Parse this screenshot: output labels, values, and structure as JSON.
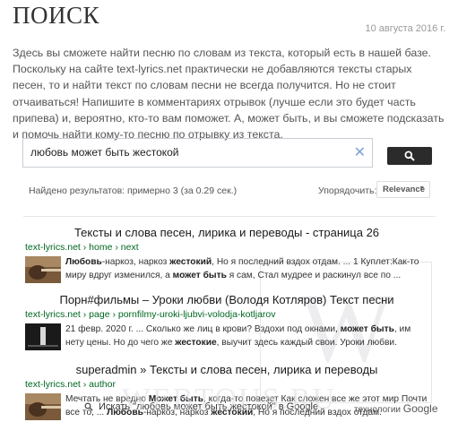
{
  "page": {
    "title": "ПОИСК",
    "date": "10 августа 2016 г.",
    "intro": "Здесь вы сможете найти песню по словам из текста, который есть в нашей базе. Поскольку на сайте text-lyrics.net практически не добавляются тексты старых песен, то и найти текст по словам песни не всегда получится. Но не стоит отчаиваться! Напишите в комментариях отрывок (лучше если это будет часть припева) и, вероятно, кто-то вам поможет. А, может быть, и вы сможете подсказать и помочь найти кому-то песню по отрывку из текста."
  },
  "search": {
    "query": "любовь может быть жестокой",
    "clear_glyph": "✕"
  },
  "stats": {
    "count": "Найдено результатов: примерно 3 (за 0.29 сек.)",
    "order_label": "Упорядочить:",
    "order_value": "Relevance"
  },
  "results": [
    {
      "title": "Тексты и слова песен, лирика и переводы - страница 26",
      "url": "text-lyrics.net › home › next",
      "snippet_html": "<b>Любовь</b>-наркоз, наркоз <b>жестокий</b>, Но я последний вздох отдам. ... 1 Куплет:Как-то миру вдруг изменился, а <b>может быть</b> я сам, Стал мудрее и раскинул все по ..."
    },
    {
      "title": "Порн#фильмы – Уроки любви (Володя Котляров) Текст песни",
      "url": "text-lyrics.net › page › pornfilmy-uroki-ljubvi-volodja-kotljarov",
      "snippet_html": "21 февр. 2020 г. ... Сколько же лиц в крови? Вздохи под окнами, <b>может быть</b>, им нету цены. Но до чего же <b>жестокие</b>, выучит здесь каждый свои. Уроки любви. Выверни, ..."
    },
    {
      "title": "superadmin » Тексты и слова песен, лирика и переводы",
      "url": "text-lyrics.net › author",
      "snippet_html": "Мечтать не вредно <b>Может быть</b>, когда-то повезет Как сложен все же этот мир Почти все то, ... <b>Любовь</b>-наркоз, наркоз <b>жестокий</b>, Но я последний вздох отдам."
    }
  ],
  "footer": {
    "google_search": "Искать \"любовь может быть жестокой\" в Google",
    "tech_label": "технологии",
    "tech_brand": "Google"
  },
  "watermark": {
    "text": "WEBTOUS.RU",
    "letter": "W"
  },
  "colors": {
    "url_green": "#006621",
    "button_dark": "#2b2b2b",
    "clear_blue": "#7aa0d8"
  }
}
